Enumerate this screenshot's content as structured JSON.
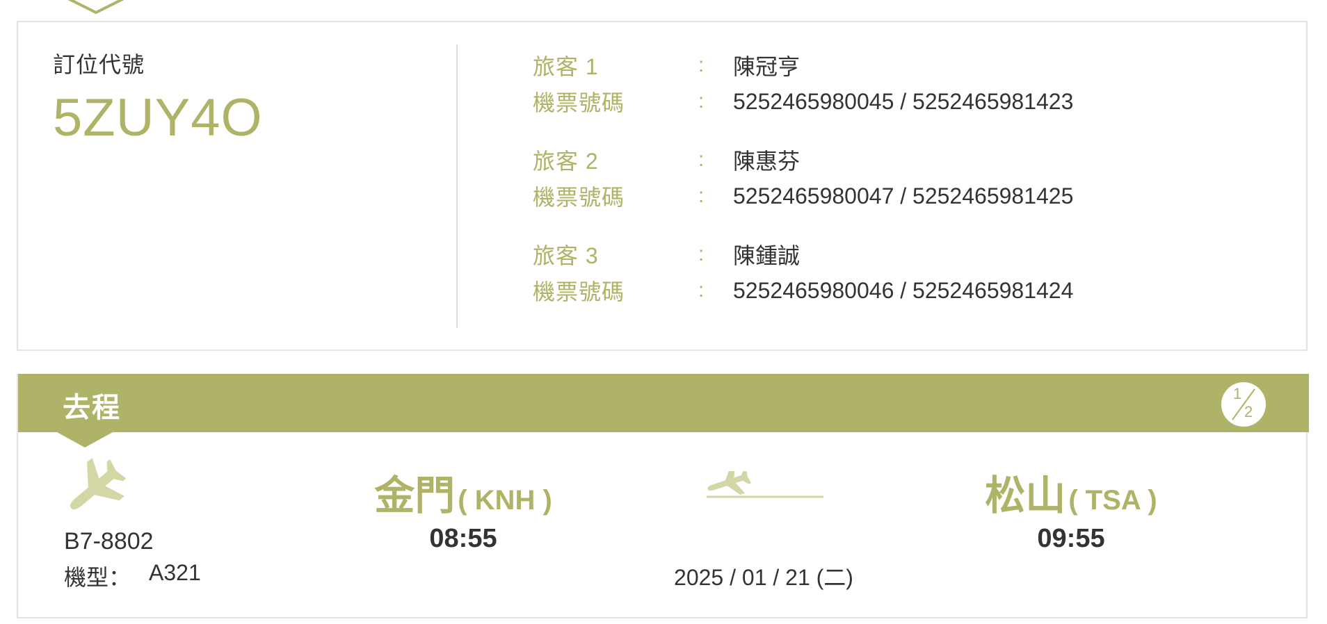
{
  "booking": {
    "label": "訂位代號",
    "code": "5ZUY4O"
  },
  "passengers": [
    {
      "label": "旅客 1",
      "name": "陳冠亨",
      "ticket_label": "機票號碼",
      "tickets": "5252465980045 / 5252465981423"
    },
    {
      "label": "旅客 2",
      "name": "陳惠芬",
      "ticket_label": "機票號碼",
      "tickets": "5252465980047 / 5252465981425"
    },
    {
      "label": "旅客 3",
      "name": "陳鍾誠",
      "ticket_label": "機票號碼",
      "tickets": "5252465980046 / 5252465981424"
    }
  ],
  "separator": ":",
  "flight": {
    "title": "去程",
    "leg_index": "1",
    "leg_total": "2",
    "number": "B7-8802",
    "aircraft_label": "機型：",
    "aircraft": "A321",
    "departure": {
      "city": "金門",
      "code": "( KNH )",
      "time": "08:55"
    },
    "arrival": {
      "city": "松山",
      "code": "( TSA )",
      "time": "09:55"
    },
    "date": "2025 / 01 / 21 (二)"
  },
  "icons": [
    "chevron-down-icon",
    "airplane-icon",
    "takeoff-icon",
    "leg-count-icon"
  ],
  "colors": {
    "accent": "#afb367",
    "accent_light": "#d3d6a5",
    "text": "#333333",
    "border": "#e3e3e3"
  }
}
